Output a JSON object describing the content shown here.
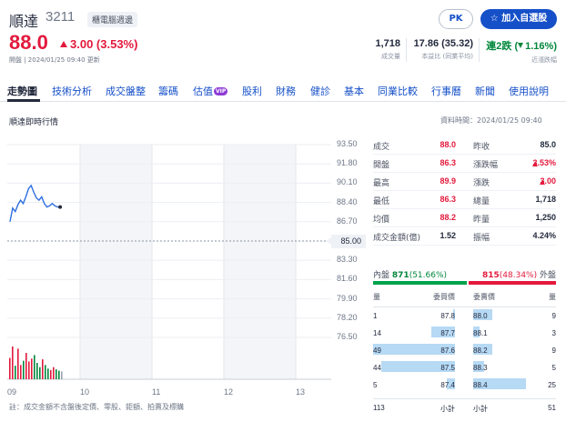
{
  "header": {
    "name": "順達",
    "code": "3211",
    "tag": "櫃電腦週邊",
    "pk_label": "PK",
    "watchlist_label": "加入自選股",
    "price": "88.0",
    "change": "3.00 (3.53%)",
    "trade_time": "開盤 | 2024/01/25 09:40 更新",
    "stats": [
      {
        "value": "1,718",
        "label": "成交量"
      },
      {
        "value": "17.86 (35.32)",
        "label": "本益比 (同業平均)"
      },
      {
        "value_main": "連2跌",
        "value_sub": "1.16%",
        "label": "近漲跌幅"
      }
    ]
  },
  "tabs": [
    "走勢圖",
    "技術分析",
    "成交盤整",
    "籌碼",
    "估值",
    "股利",
    "財務",
    "健診",
    "基本",
    "同業比較",
    "行事曆",
    "新聞",
    "使用說明"
  ],
  "vip_badge": "VIP",
  "section": {
    "title": "順達即時行情",
    "data_time": "資料時間：2024/01/25 09:40"
  },
  "chart_data": {
    "type": "line",
    "title": "",
    "xlabel": "",
    "ylabel": "",
    "x_ticks": [
      "09",
      "10",
      "11",
      "12",
      "13"
    ],
    "y_ticks": [
      "93.50",
      "91.80",
      "90.10",
      "88.40",
      "86.70",
      "83.30",
      "81.60",
      "79.90",
      "78.20",
      "76.50"
    ],
    "ylim": [
      76.5,
      93.5
    ],
    "reference_price": "85.00",
    "reference_value": 85.0,
    "price_series": [
      {
        "t": 0,
        "v": 86.7
      },
      {
        "t": 1,
        "v": 87.9
      },
      {
        "t": 2,
        "v": 87.6
      },
      {
        "t": 3,
        "v": 88.2
      },
      {
        "t": 4,
        "v": 88.6
      },
      {
        "t": 5,
        "v": 88.3
      },
      {
        "t": 6,
        "v": 88.9
      },
      {
        "t": 7,
        "v": 89.6
      },
      {
        "t": 8,
        "v": 89.9
      },
      {
        "t": 9,
        "v": 89.3
      },
      {
        "t": 10,
        "v": 88.8
      },
      {
        "t": 11,
        "v": 88.6
      },
      {
        "t": 12,
        "v": 88.9
      },
      {
        "t": 13,
        "v": 88.3
      },
      {
        "t": 14,
        "v": 88.0
      },
      {
        "t": 15,
        "v": 88.1
      },
      {
        "t": 16,
        "v": 88.3
      },
      {
        "t": 17,
        "v": 88.1
      },
      {
        "t": 18,
        "v": 88.0
      },
      {
        "t": 19,
        "v": 88.0
      }
    ],
    "volume_series": [
      60,
      92,
      38,
      86,
      40,
      52,
      74,
      50,
      58,
      68,
      46,
      34,
      56,
      40,
      30,
      26,
      34,
      28,
      24,
      22
    ],
    "volume_colors": {
      "up": "#e3193c",
      "down": "#00873c",
      "flat": "#9aa3b1"
    },
    "volume_types": [
      "up",
      "up",
      "down",
      "up",
      "up",
      "down",
      "up",
      "up",
      "up",
      "down",
      "down",
      "down",
      "up",
      "down",
      "down",
      "up",
      "up",
      "down",
      "down",
      "flat"
    ]
  },
  "quote_table": [
    {
      "l1": "成交",
      "v1": "88.0",
      "c1": "red",
      "l2": "昨收",
      "v2": "85.0",
      "c2": "dark"
    },
    {
      "l1": "開盤",
      "v1": "86.3",
      "c1": "red",
      "l2": "漲跌幅",
      "v2": "3.53%",
      "c2": "red",
      "arrow2": "up"
    },
    {
      "l1": "最高",
      "v1": "89.9",
      "c1": "red",
      "l2": "漲跌",
      "v2": "3.00",
      "c2": "red",
      "arrow2": "up"
    },
    {
      "l1": "最低",
      "v1": "86.3",
      "c1": "red",
      "l2": "總量",
      "v2": "1,718",
      "c2": "dark"
    },
    {
      "l1": "均價",
      "v1": "88.2",
      "c1": "red",
      "l2": "昨量",
      "v2": "1,250",
      "c2": "dark"
    },
    {
      "l1": "成交金額(億)",
      "v1": "1.52",
      "c1": "dark",
      "l2": "振幅",
      "v2": "4.24%",
      "c2": "dark"
    }
  ],
  "inside_outside": {
    "inside_label": "內盤",
    "inside_value": "871",
    "inside_pct": "(51.66%)",
    "inside_ratio": 0.5166,
    "outside_value": "815",
    "outside_pct": "(48.34%)",
    "outside_label": "外盤",
    "outside_ratio": 0.4834
  },
  "order_book": {
    "headers": {
      "bid_vol": "量",
      "bid_price": "委買價",
      "ask_price": "委賣價",
      "ask_vol": "量"
    },
    "rows": [
      {
        "bid_vol": "1",
        "bid_price": "87.8",
        "ask_price": "88.0",
        "ask_vol": "9",
        "bid_ratio": 0.02,
        "ask_ratio": 0.36
      },
      {
        "bid_vol": "14",
        "bid_price": "87.7",
        "ask_price": "88.1",
        "ask_vol": "3",
        "bid_ratio": 0.29,
        "ask_ratio": 0.12
      },
      {
        "bid_vol": "49",
        "bid_price": "87.6",
        "ask_price": "88.2",
        "ask_vol": "9",
        "bid_ratio": 1.0,
        "ask_ratio": 0.36
      },
      {
        "bid_vol": "44",
        "bid_price": "87.5",
        "ask_price": "88.3",
        "ask_vol": "5",
        "bid_ratio": 0.9,
        "ask_ratio": 0.2
      },
      {
        "bid_vol": "5",
        "bid_price": "87.4",
        "ask_price": "88.4",
        "ask_vol": "25",
        "bid_ratio": 0.1,
        "ask_ratio": 1.0
      }
    ],
    "totals": {
      "bid_total": "113",
      "bid_label": "小計",
      "ask_label": "小計",
      "ask_total": "51"
    }
  },
  "footnote": "註：成交金額不含盤後定價、零股、鉅額、拍賣及標購",
  "colors": {
    "up": "#e3193c",
    "down": "#00873c",
    "accent": "#1650c9",
    "line": "#2f6fe0"
  }
}
